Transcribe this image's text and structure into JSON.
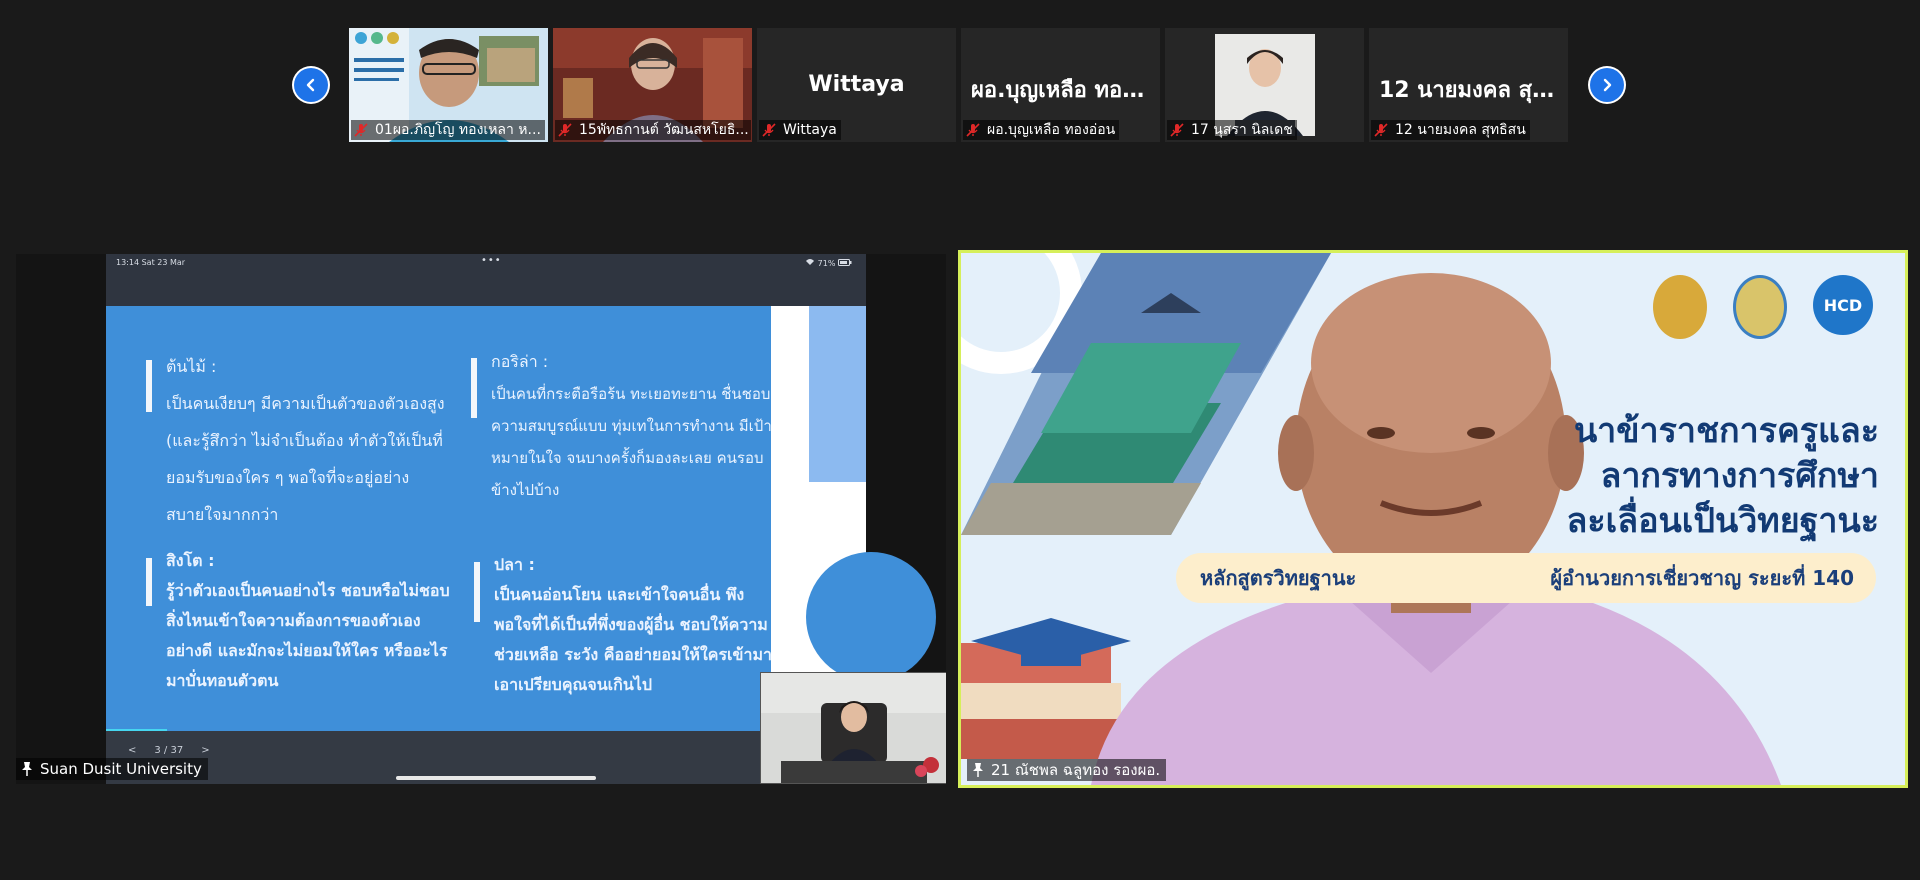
{
  "strip": {
    "prev_label": "previous participants",
    "next_label": "next participants",
    "tiles": [
      {
        "display": "",
        "label": "01ผอ.ภิญโญ  ทองเหลา ห...",
        "muted": true,
        "has_video": true
      },
      {
        "display": "",
        "label": "15พัทธกานต์  วัฒนสหโยธิ...",
        "muted": true,
        "has_video": true
      },
      {
        "display": "Wittaya",
        "label": "Wittaya",
        "muted": true,
        "has_video": false
      },
      {
        "display": "ผอ.บุญเหลือ ทอง...",
        "label": "ผอ.บุญเหลือ ทองอ่อน",
        "muted": true,
        "has_video": false
      },
      {
        "display": "",
        "label": "17 นุสรา นิลเดช",
        "muted": true,
        "has_video": true
      },
      {
        "display": "12 นายมงคล สุท...",
        "label": "12 นายมงคล สุทธิสน",
        "muted": true,
        "has_video": false
      }
    ]
  },
  "screen_share": {
    "ipad_time": "13:14  Sat 23 Mar",
    "ipad_dots": "•••",
    "ipad_battery": "71%",
    "slide": {
      "tl_title": "ต้นไม้ :",
      "tl_body": "เป็นคนเงียบๆ มีความเป็นตัวของตัวเองสูง (และรู้สึกว่า ไม่จำเป็นต้อง ทำตัวให้เป็นที่ยอมรับของใคร ๆ พอใจที่จะอยู่อย่างสบายใจมากกว่า",
      "tr_title": "กอริล่า :",
      "tr_body": "เป็นคนที่กระตือรือร้น ทะเยอทะยาน ชื่นชอบความสมบูรณ์แบบ ทุ่มเทในการทำงาน มีเป้าหมายในใจ จนบางครั้งก็มองละเลย คนรอบข้างไปบ้าง",
      "bl_title": "สิงโต :",
      "bl_body": "รู้ว่าตัวเองเป็นคนอย่างไร ชอบหรือไม่ชอบสิ่งไหนเข้าใจความต้องการของตัวเองอย่างดี และมักจะไม่ยอมให้ใคร หรืออะไร มาบั่นทอนตัวตน",
      "br_title": "ปลา :",
      "br_body": "เป็นคนอ่อนโยน และเข้าใจคนอื่น พึงพอใจที่ได้เป็นที่พึ่งของผู้อื่น ชอบให้ความช่วยเหลือ ระวัง คืออย่ายอมให้ใครเข้ามาเอาเปรียบคุณจนเกินไป",
      "progress_fraction": 0.08
    },
    "pager": {
      "prev": "<",
      "page": "3 / 37",
      "next": ">"
    },
    "presenter_name": "Suan Dusit University"
  },
  "speaker": {
    "name": "21 ณัชพล ฉลูทอง รองผอ.",
    "title_line1": "นาข้าราชการครูและ",
    "title_line2": "ลากรทางการศึกษา",
    "title_line3": "ละเลื่อนเป็นวิทยฐานะ",
    "band_start": "หลักสูตรวิทยฐานะ",
    "band_end": "ผู้อำนวยการเชี่ยวชาญ ระยะที่ 140",
    "logo_hcd": "HCD"
  },
  "colors": {
    "active_speaker_border": "#d6ef5a",
    "nav_blue": "#1e73e8",
    "muted_red": "#e02828",
    "slide_blue": "#3f8fd9"
  }
}
